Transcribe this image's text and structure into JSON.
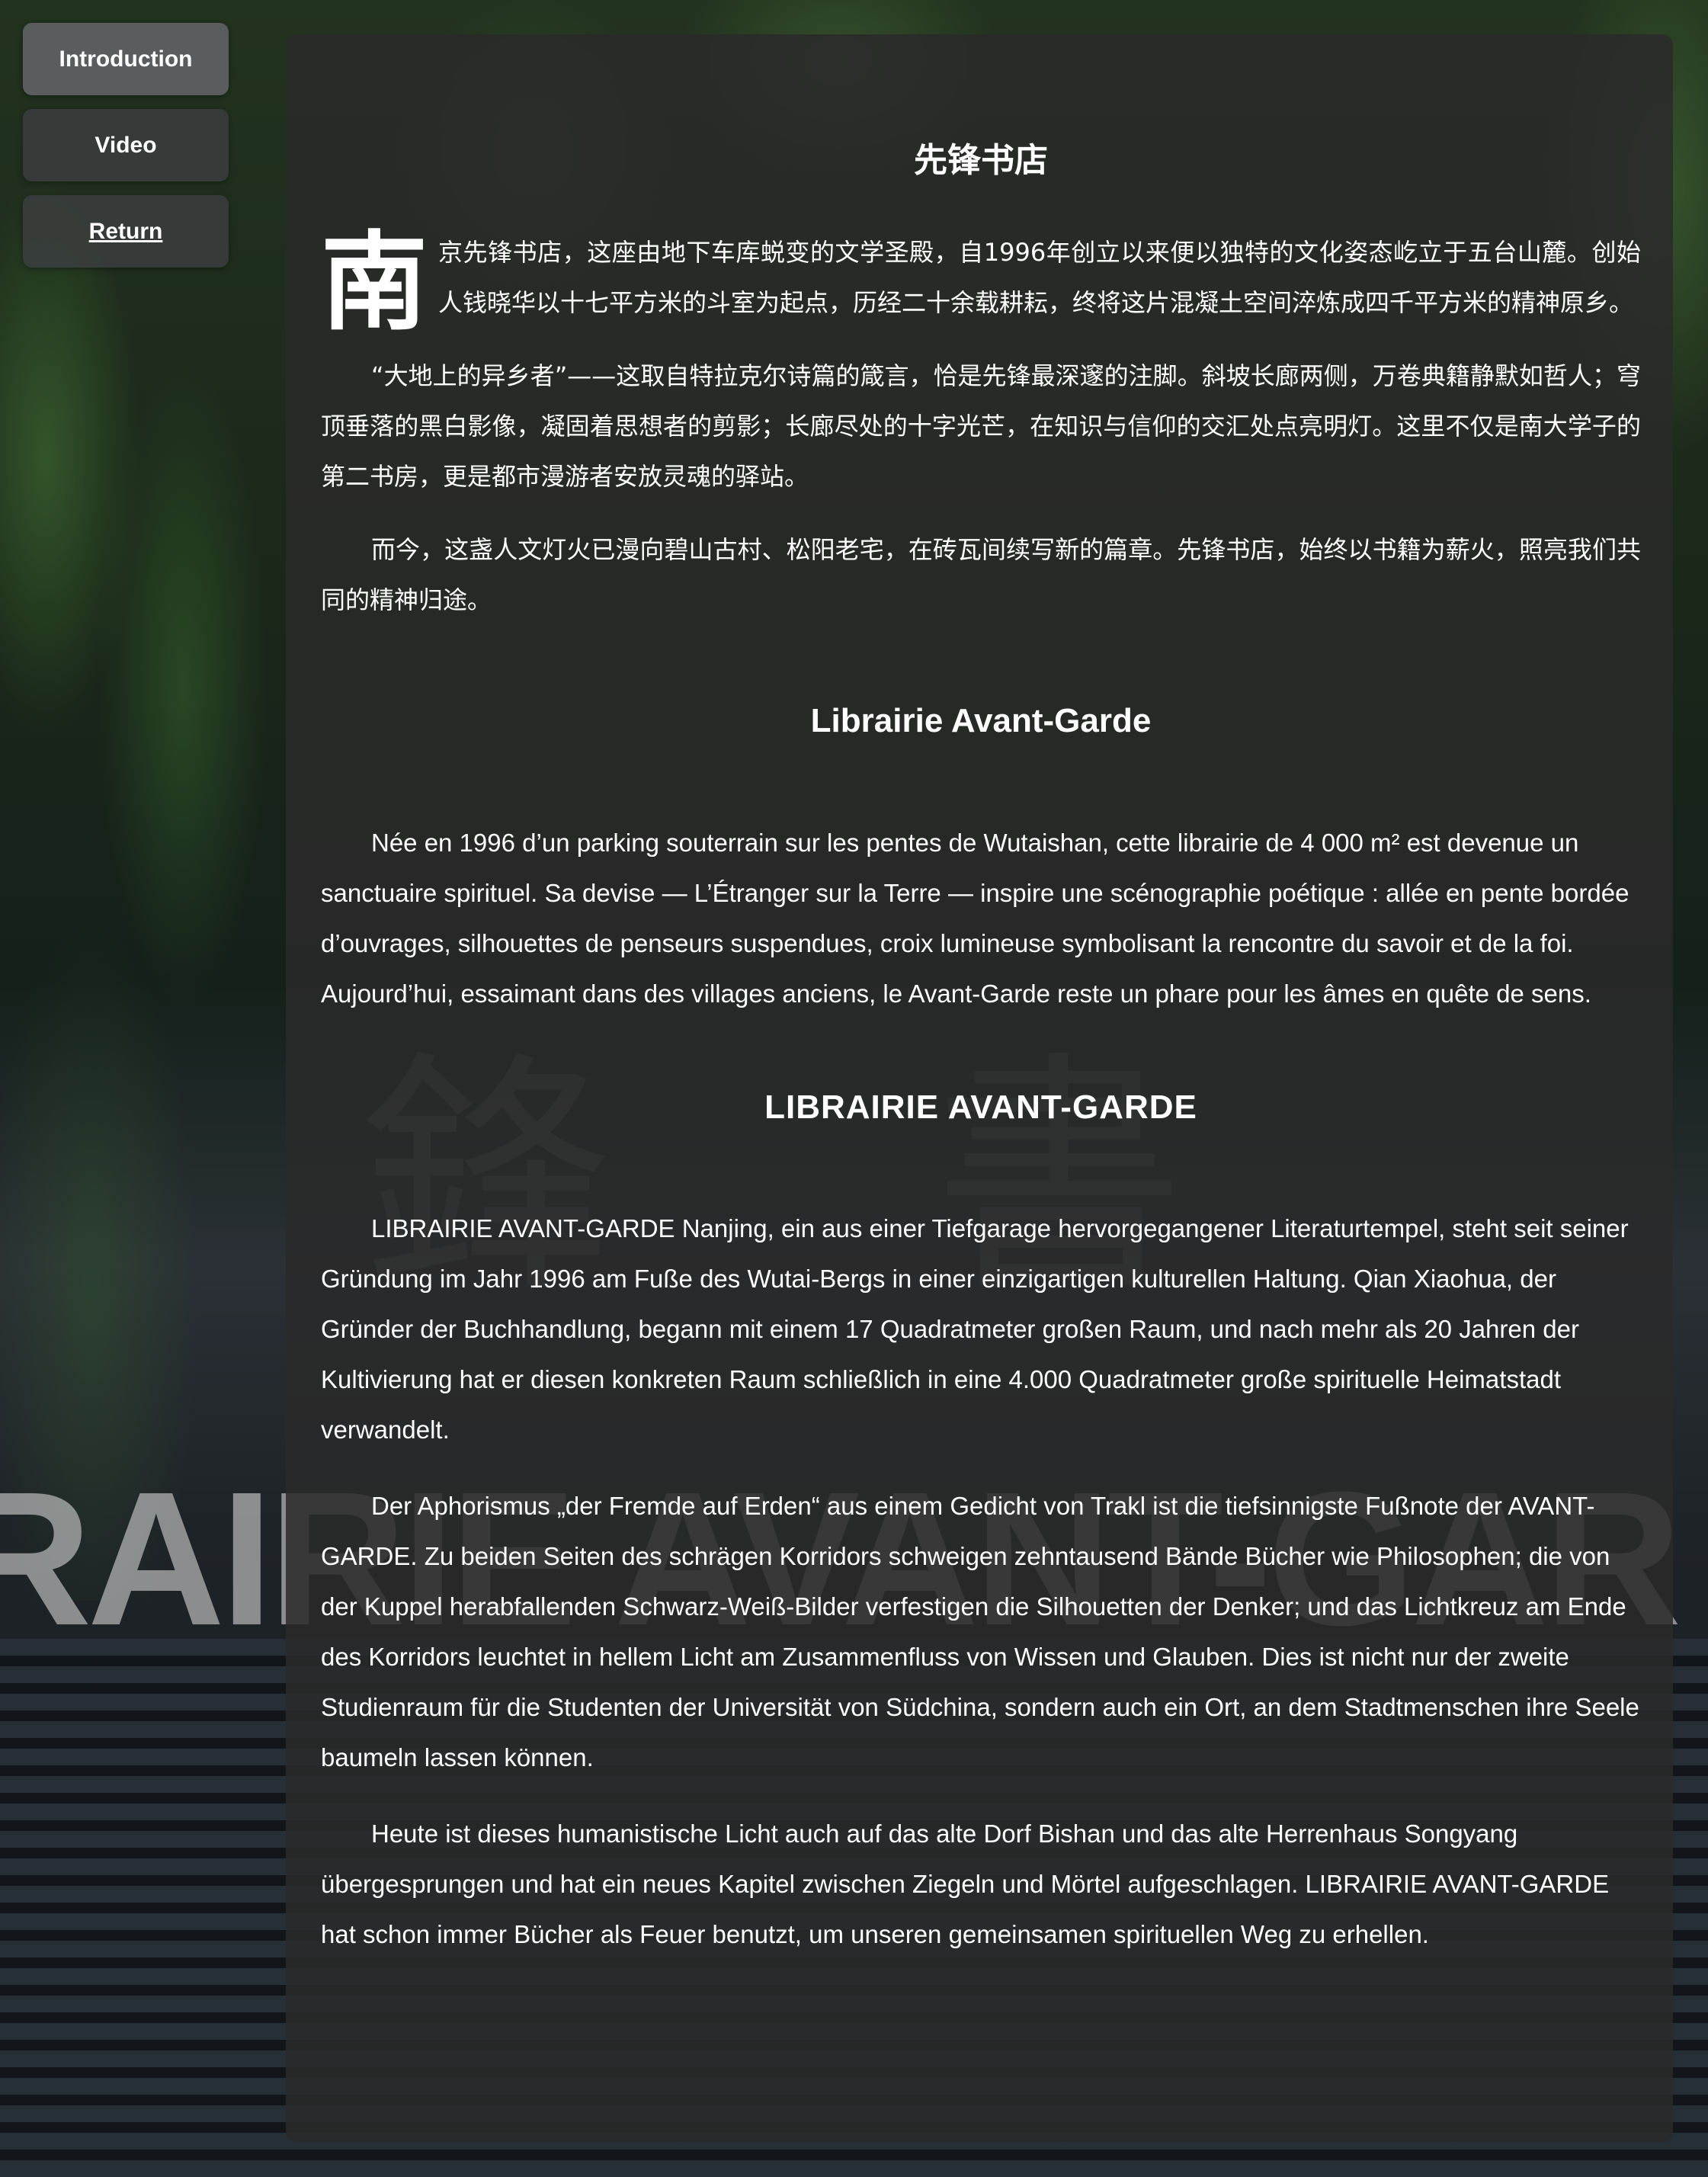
{
  "nav": {
    "items": [
      {
        "label": "Introduction",
        "state": "active"
      },
      {
        "label": "Video",
        "state": "normal"
      },
      {
        "label": "Return",
        "state": "link"
      }
    ]
  },
  "background": {
    "sign_chinese": "鋒 書",
    "sign_latin": "RAIRIE AVANT-GAR"
  },
  "chinese": {
    "title": "先锋书店",
    "drop_cap": "南",
    "paragraphs": [
      "京先锋书店，这座由地下车库蜕变的文学圣殿，自1996年创立以来便以独特的文化姿态屹立于五台山麓。创始人钱晓华以十七平方米的斗室为起点，历经二十余载耕耘，终将这片混凝土空间淬炼成四千平方米的精神原乡。",
      "“大地上的异乡者”——这取自特拉克尔诗篇的箴言，恰是先锋最深邃的注脚。斜坡长廊两侧，万卷典籍静默如哲人；穹顶垂落的黑白影像，凝固着思想者的剪影；长廊尽处的十字光芒，在知识与信仰的交汇处点亮明灯。这里不仅是南大学子的第二书房，更是都市漫游者安放灵魂的驿站。",
      "而今，这盏人文灯火已漫向碧山古村、松阳老宅，在砖瓦间续写新的篇章。先锋书店，始终以书籍为薪火，照亮我们共同的精神归途。"
    ]
  },
  "french": {
    "title": "Librairie Avant-Garde",
    "paragraphs": [
      "Née en 1996 d’un parking souterrain sur les pentes de Wutaishan, cette librairie de 4 000 m² est devenue un sanctuaire spirituel. Sa devise — L’Étranger sur la Terre — inspire une scénographie poétique : allée en pente bordée d’ouvrages, silhouettes de penseurs suspendues, croix lumineuse symbolisant la rencontre du savoir et de la foi. Aujourd’hui, essaimant dans des villages anciens, le Avant-Garde reste un phare pour les âmes en quête de sens."
    ]
  },
  "german": {
    "title": "LIBRAIRIE AVANT-GARDE",
    "paragraphs": [
      "LIBRAIRIE AVANT-GARDE Nanjing, ein aus einer Tiefgarage hervorgegangener Literaturtempel, steht seit seiner Gründung im Jahr 1996 am Fuße des Wutai-Bergs in einer einzigartigen kulturellen Haltung. Qian Xiaohua, der Gründer der Buchhandlung, begann mit einem 17 Quadratmeter großen Raum, und nach mehr als 20 Jahren der Kultivierung hat er diesen konkreten Raum schließlich in eine 4.000 Quadratmeter große spirituelle Heimatstadt verwandelt.",
      "Der Aphorismus „der Fremde auf Erden“ aus einem Gedicht von Trakl ist die tiefsinnigste Fußnote der AVANT-GARDE. Zu beiden Seiten des schrägen Korridors schweigen zehntausend Bände Bücher wie Philosophen; die von der Kuppel herabfallenden Schwarz-Weiß-Bilder verfestigen die Silhouetten der Denker; und das Lichtkreuz am Ende des Korridors leuchtet in hellem Licht am Zusammenfluss von Wissen und Glauben. Dies ist nicht nur der zweite Studienraum für die Studenten der Universität von Südchina, sondern auch ein Ort, an dem Stadtmenschen ihre Seele baumeln lassen können.",
      "Heute ist dieses humanistische Licht auch auf das alte Dorf Bishan und das alte Herrenhaus Songyang übergesprungen und hat ein neues Kapitel zwischen Ziegeln und Mörtel aufgeschlagen. LIBRAIRIE AVANT-GARDE hat schon immer Bücher als Feuer benutzt, um unseren gemeinsamen spirituellen Weg zu erhellen."
    ]
  },
  "colors": {
    "panel": "#2a2a2a",
    "text": "#ffffff",
    "nav_button": "#3c3e40"
  }
}
